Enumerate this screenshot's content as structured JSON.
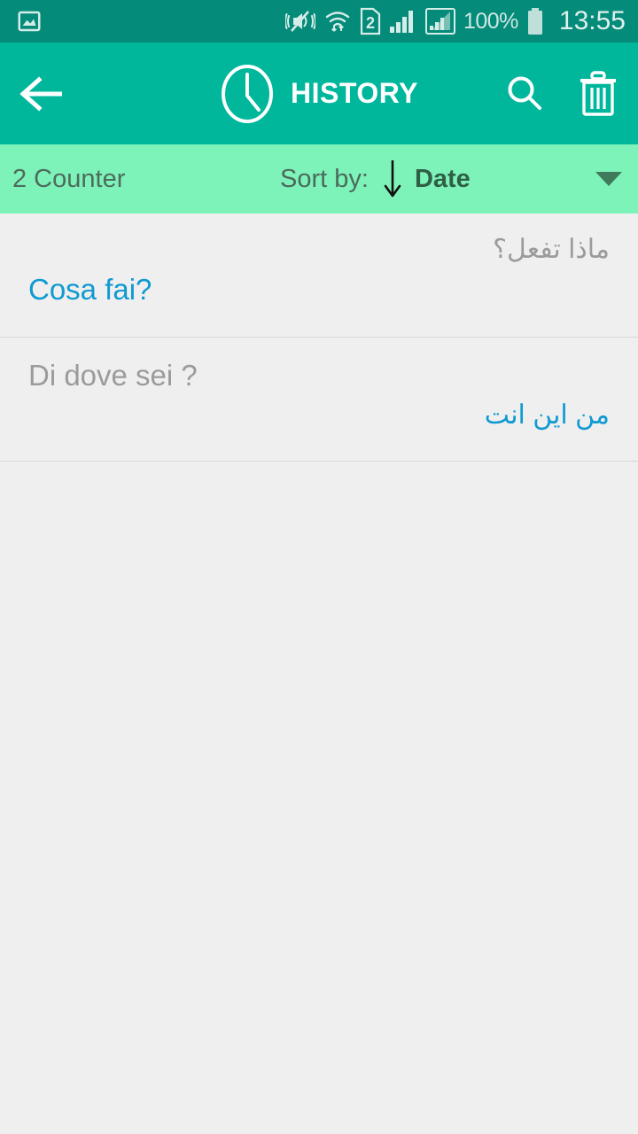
{
  "status_bar": {
    "icons": [
      "image-icon",
      "vibrate-mute-icon",
      "wifi-icon",
      "sim2-icon",
      "signal-bars-icon",
      "signal-bars-boxed-icon"
    ],
    "battery_percent": "100%",
    "battery_icon": "battery-full-icon",
    "time": "13:55",
    "background_color": "#048b79",
    "foreground_color": "#d6ece8"
  },
  "app_bar": {
    "back_icon": "arrow-left-icon",
    "clock_icon": "clock-icon",
    "title": "HISTORY",
    "search_icon": "search-icon",
    "delete_icon": "trash-icon",
    "background_color": "#00b79c",
    "title_color": "#ffffff"
  },
  "sort_bar": {
    "counter_label": "2 Counter",
    "sort_by_label": "Sort by:",
    "sort_direction_icon": "arrow-down-icon",
    "sort_value": "Date",
    "dropdown_icon": "chevron-down-icon",
    "background_color": "#7ef3b9",
    "counter_color": "#4e6b5e",
    "value_color": "#2f5f45"
  },
  "history": {
    "items": [
      {
        "source_text": "ماذا تفعل؟",
        "source_dir": "rtl",
        "target_text": "Cosa fai?",
        "target_dir": "ltr"
      },
      {
        "source_text": "Di dove sei ?",
        "source_dir": "ltr",
        "target_text": "من اين انت",
        "target_dir": "rtl"
      }
    ],
    "source_color": "#9b9b9b",
    "target_color": "#0f9ad1",
    "background_color": "#efefef",
    "divider_color": "#d8d8d8"
  }
}
